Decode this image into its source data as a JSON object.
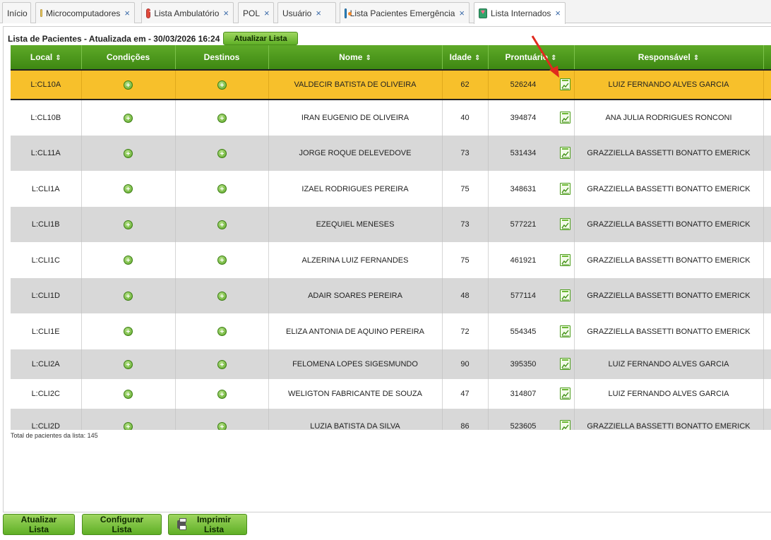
{
  "tabs": [
    {
      "label": "Início",
      "icon": null,
      "closable": false,
      "active": false
    },
    {
      "label": "Microcomputadores",
      "icon": "micro-icon",
      "closable": true,
      "active": false
    },
    {
      "label": "Lista Ambulatório",
      "icon": "ambulatorio-icon",
      "closable": true,
      "active": false
    },
    {
      "label": "POL",
      "icon": null,
      "closable": true,
      "active": false
    },
    {
      "label": "Usuário",
      "icon": null,
      "closable": true,
      "active": false
    },
    {
      "label": "Lista Pacientes Emergência",
      "icon": "emergencia-icon",
      "closable": true,
      "active": false
    },
    {
      "label": "Lista Internados",
      "icon": "internados-icon",
      "closable": true,
      "active": true
    }
  ],
  "close_glyph": "×",
  "header": {
    "title": "Lista de Pacientes - Atualizada em - 30/03/2026 16:24",
    "refresh_label": "Atualizar Lista"
  },
  "table": {
    "columns": [
      "Local",
      "Condições",
      "Destinos",
      "Nome",
      "Idade",
      "Prontuário",
      "Responsável"
    ],
    "sortable": [
      true,
      false,
      false,
      true,
      true,
      true,
      true
    ],
    "sort_glyph": "⇕",
    "rows": [
      {
        "local": "L:CL10A",
        "nome": "VALDECIR BATISTA DE OLIVEIRA",
        "idade": "62",
        "prontuario": "526244",
        "responsavel": "LUIZ FERNANDO ALVES GARCIA",
        "style": "selected"
      },
      {
        "local": "L:CL10B",
        "nome": "IRAN EUGENIO DE OLIVEIRA",
        "idade": "40",
        "prontuario": "394874",
        "responsavel": "ANA JULIA RODRIGUES RONCONI",
        "style": "white"
      },
      {
        "local": "L:CL11A",
        "nome": "JORGE ROQUE DELEVEDOVE",
        "idade": "73",
        "prontuario": "531434",
        "responsavel": "GRAZZIELLA BASSETTI BONATTO EMERICK",
        "style": "gray"
      },
      {
        "local": "L:CLI1A",
        "nome": "IZAEL RODRIGUES PEREIRA",
        "idade": "75",
        "prontuario": "348631",
        "responsavel": "GRAZZIELLA BASSETTI BONATTO EMERICK",
        "style": "white"
      },
      {
        "local": "L:CLI1B",
        "nome": "EZEQUIEL MENESES",
        "idade": "73",
        "prontuario": "577221",
        "responsavel": "GRAZZIELLA BASSETTI BONATTO EMERICK",
        "style": "gray"
      },
      {
        "local": "L:CLI1C",
        "nome": "ALZERINA LUIZ FERNANDES",
        "idade": "75",
        "prontuario": "461921",
        "responsavel": "GRAZZIELLA BASSETTI BONATTO EMERICK",
        "style": "white"
      },
      {
        "local": "L:CLI1D",
        "nome": "ADAIR SOARES PEREIRA",
        "idade": "48",
        "prontuario": "577114",
        "responsavel": "GRAZZIELLA BASSETTI BONATTO EMERICK",
        "style": "gray"
      },
      {
        "local": "L:CLI1E",
        "nome": "ELIZA ANTONIA DE AQUINO PEREIRA",
        "idade": "72",
        "prontuario": "554345",
        "responsavel": "GRAZZIELLA BASSETTI BONATTO EMERICK",
        "style": "white"
      },
      {
        "local": "L:CLI2A",
        "nome": "FELOMENA LOPES SIGESMUNDO",
        "idade": "90",
        "prontuario": "395350",
        "responsavel": "LUIZ FERNANDO ALVES GARCIA",
        "style": "gray"
      },
      {
        "local": "L:CLI2C",
        "nome": "WELIGTON FABRICANTE DE SOUZA",
        "idade": "47",
        "prontuario": "314807",
        "responsavel": "LUIZ FERNANDO ALVES GARCIA",
        "style": "white"
      },
      {
        "local": "L:CLI2D",
        "nome": "LUZIA BATISTA DA SILVA",
        "idade": "86",
        "prontuario": "523605",
        "responsavel": "GRAZZIELLA BASSETTI BONATTO EMERICK",
        "style": "gray"
      }
    ]
  },
  "footer": {
    "total_text": "Total de pacientes da lista: 145",
    "buttons": {
      "refresh": "Atualizar Lista",
      "configure": "Configurar Lista",
      "print": "Imprimir Lista"
    }
  },
  "colors": {
    "header_green": "#4f9b1e",
    "selected_row": "#f7c02b",
    "gray_row": "#d8d8d8",
    "annotation_arrow": "#e02a1e"
  }
}
